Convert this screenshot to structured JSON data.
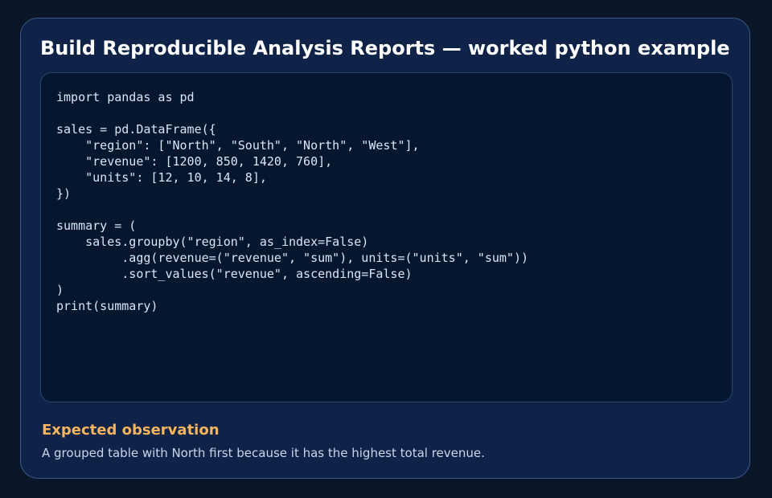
{
  "card": {
    "title": "Build Reproducible Analysis Reports — worked python example"
  },
  "code_block": {
    "language": "python",
    "lines": [
      "import pandas as pd",
      "",
      "sales = pd.DataFrame({",
      "    \"region\": [\"North\", \"South\", \"North\", \"West\"],",
      "    \"revenue\": [1200, 850, 1420, 760],",
      "    \"units\": [12, 10, 14, 8],",
      "})",
      "",
      "summary = (",
      "    sales.groupby(\"region\", as_index=False)",
      "         .agg(revenue=(\"revenue\", \"sum\"), units=(\"units\", \"sum\"))",
      "         .sort_values(\"revenue\", ascending=False)",
      ")",
      "print(summary)"
    ]
  },
  "observation": {
    "heading": "Expected observation",
    "text": "A grouped table with North first because it has the highest total revenue."
  },
  "colors": {
    "page_background": "#0a1628",
    "card_background": "#0e2347",
    "card_border": "#3a5a8c",
    "code_background": "#04172f",
    "code_text": "#dbe6f5",
    "accent": "#f6b45e"
  }
}
